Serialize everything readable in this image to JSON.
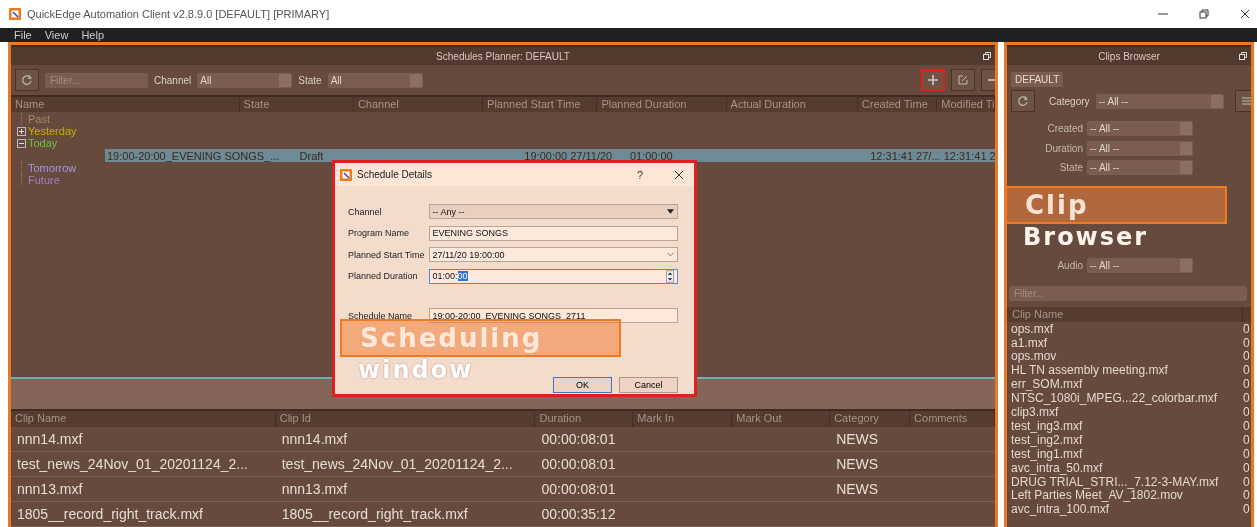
{
  "window": {
    "title": "QuickEdge Automation Client v2.8.9.0 [DEFAULT] [PRIMARY]"
  },
  "menu": [
    "File",
    "View",
    "Help"
  ],
  "schedules_planner": {
    "title": "Schedules Planner: DEFAULT",
    "filter_placeholder": "Filter...",
    "channel_label": "Channel",
    "channel_value": "All",
    "state_label": "State",
    "state_value": "All",
    "columns": [
      "Name",
      "State",
      "Channel",
      "Planned Start Time",
      "Planned Duration",
      "Actual Duration",
      "Created Time",
      "Modified Ti"
    ],
    "tree": [
      {
        "label": "Past",
        "color": "#a08a66"
      },
      {
        "label": "Yesterday",
        "color": "#c8b000",
        "expanded": false
      },
      {
        "label": "Today",
        "color": "#66c544",
        "expanded": true,
        "children": [
          {
            "selected": true,
            "cells": [
              "19:00-20:00_EVENING SONGS_...",
              "Draft",
              "",
              "19:00:00 27/11/20",
              "01:00:00",
              "",
              "12:31:41 27/...",
              "12:31:41 2"
            ]
          }
        ]
      },
      {
        "label": "Tomorrow",
        "color": "#9d9ce0"
      },
      {
        "label": "Future",
        "color": "#a080c0"
      }
    ]
  },
  "clips_table": {
    "columns": [
      "Clip Name",
      "Clip Id",
      "Duration",
      "Mark In",
      "Mark Out",
      "Category",
      "Comments"
    ],
    "rows": [
      {
        "cells": [
          "nnn14.mxf",
          "nnn14.mxf",
          "00:00:08:01",
          "",
          "",
          "NEWS",
          ""
        ]
      },
      {
        "cells": [
          "test_news_24Nov_01_20201124_2...",
          "test_news_24Nov_01_20201124_2...",
          "00:00:08:01",
          "",
          "",
          "NEWS",
          ""
        ]
      },
      {
        "cells": [
          "nnn13.mxf",
          "nnn13.mxf",
          "00:00:08:01",
          "",
          "",
          "NEWS",
          ""
        ]
      },
      {
        "cells": [
          "1805__record_right_track.mxf",
          "1805__record_right_track.mxf",
          "00:00:35:12",
          "",
          "",
          "",
          ""
        ]
      }
    ]
  },
  "clips_browser": {
    "title": "Clips Browser",
    "tabs": [
      {
        "label": "DEFAULT",
        "selected": true
      }
    ],
    "category_label": "Category",
    "category_value": "-- All --",
    "filters": [
      {
        "label": "Created",
        "value": "-- All --"
      },
      {
        "label": "Duration",
        "value": "-- All --"
      },
      {
        "label": "State",
        "value": "-- All --"
      },
      {
        "kind": "covered"
      },
      {
        "kind": "covered"
      },
      {
        "kind": "covered"
      },
      {
        "kind": "covered"
      },
      {
        "label": "Audio",
        "value": "-- All --"
      }
    ],
    "filter_placeholder": "Filter...",
    "list_header": "Clip Name",
    "clips": [
      {
        "name": "ops.mxf",
        "column_2": "0"
      },
      {
        "name": "a1.mxf",
        "column_2": "0"
      },
      {
        "name": "ops.mov",
        "column_2": "0"
      },
      {
        "name": "HL TN assembly meeting.mxf",
        "column_2": "0"
      },
      {
        "name": "err_SOM.mxf",
        "column_2": "0"
      },
      {
        "name": "NTSC_1080i_MPEG...22_colorbar.mxf",
        "column_2": "0"
      },
      {
        "name": "clip3.mxf",
        "column_2": "0"
      },
      {
        "name": "test_ing3.mxf",
        "column_2": "0"
      },
      {
        "name": "test_ing2.mxf",
        "column_2": "0"
      },
      {
        "name": "test_ing1.mxf",
        "column_2": "0"
      },
      {
        "name": "avc_intra_50.mxf",
        "column_2": "0"
      },
      {
        "name": "DRUG TRIAL_STRI..._7.12-3-MAY.mxf",
        "column_2": "0"
      },
      {
        "name": "Left Parties Meet_AV_1802.mov",
        "column_2": "0"
      },
      {
        "name": "avc_intra_100.mxf",
        "column_2": "0"
      }
    ]
  },
  "dialog": {
    "title": "Schedule Details",
    "help": "?",
    "fields": [
      {
        "label": "Channel",
        "kind": "select",
        "value": "-- Any --"
      },
      {
        "label": "Program Name",
        "kind": "text",
        "value": "EVENING SONGS"
      },
      {
        "label": "Planned Start Time",
        "kind": "datetime",
        "value": "27/11/20 19:00:00"
      },
      {
        "label": "Planned Duration",
        "kind": "spin",
        "value": "01:00:",
        "selected_text": "00"
      },
      {
        "label": "Schedule Name",
        "kind": "text",
        "value": "19:00-20:00_EVENING SONGS_2711"
      }
    ],
    "buttons": [
      {
        "label": "OK",
        "default": true
      },
      {
        "label": "Cancel",
        "default": false
      }
    ]
  },
  "annotations": [
    {
      "kind": "scheduling",
      "lines": [
        "Scheduling",
        "window"
      ]
    },
    {
      "kind": "browser",
      "lines": [
        "Clip",
        "Browser"
      ]
    }
  ]
}
